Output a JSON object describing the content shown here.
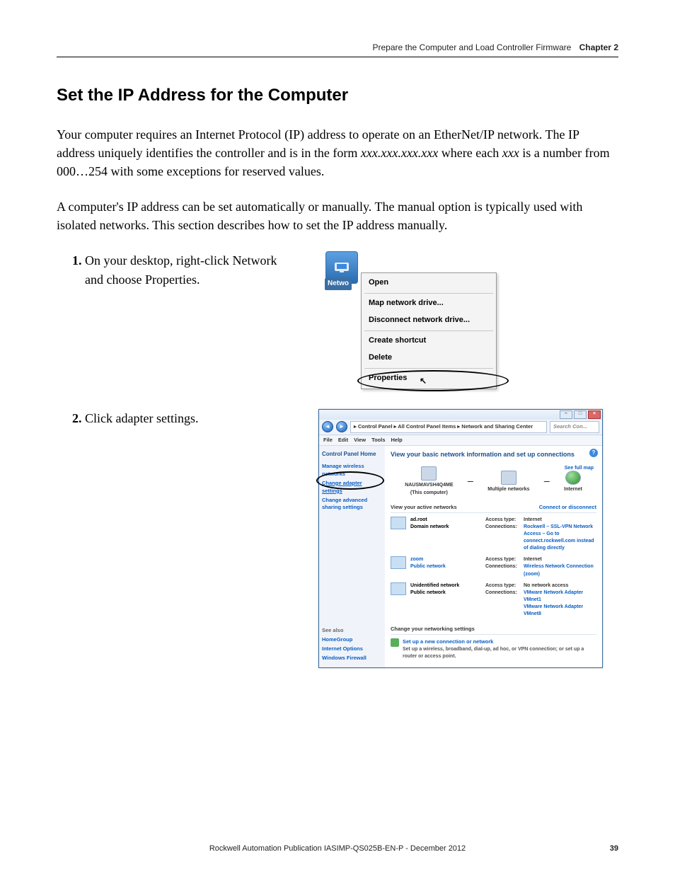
{
  "header": {
    "running_title": "Prepare the Computer and Load Controller Firmware",
    "chapter_label": "Chapter 2"
  },
  "section": {
    "title": "Set the IP Address for the Computer",
    "para1_a": "Your computer requires an Internet Protocol (IP) address to operate on an EtherNet/IP network. The IP address uniquely identifies the controller and is in the form ",
    "para1_b": "xxx.xxx.xxx.xxx",
    "para1_c": " where each ",
    "para1_d": "xxx",
    "para1_e": " is a number from 000…254 with some exceptions for reserved values.",
    "para2": "A computer's IP address can be set automatically or manually. The manual option is typically used with isolated networks. This section describes how to set the IP address manually."
  },
  "steps": {
    "s1": "On your desktop, right-click Network and choose Properties.",
    "s2": "Click adapter settings."
  },
  "context_menu": {
    "icon_label": "Netwo",
    "open": "Open",
    "map_drive": "Map network drive...",
    "disconnect_drive": "Disconnect network drive...",
    "create_shortcut": "Create shortcut",
    "delete": "Delete",
    "properties": "Properties"
  },
  "ncs": {
    "breadcrumb": "▸ Control Panel ▸ All Control Panel Items ▸ Network and Sharing Center",
    "search_placeholder": "Search Con...",
    "menu": {
      "file": "File",
      "edit": "Edit",
      "view": "View",
      "tools": "Tools",
      "help": "Help"
    },
    "side": {
      "home": "Control Panel Home",
      "manage": "Manage wireless networks",
      "adapter": "Change adapter settings",
      "advanced": "Change advanced sharing settings",
      "seealso": "See also",
      "homegroup": "HomeGroup",
      "inetopt": "Internet Options",
      "firewall": "Windows Firewall"
    },
    "main": {
      "title": "View your basic network information and set up connections",
      "see_full": "See full map",
      "computer": "NAUSMAVSH4Q4ME",
      "computer_sub": "(This computer)",
      "multi": "Multiple networks",
      "internet": "Internet",
      "active_title": "View your active networks",
      "connect_dc": "Connect or disconnect",
      "net1": {
        "name": "ad.root",
        "type": "Domain network",
        "access_lbl": "Access type:",
        "access_val": "Internet",
        "conn_lbl": "Connections:",
        "conn_val": "Rockwell – SSL-VPN Network Access – Go to connect.rockwell.com instead of dialing directly"
      },
      "net2": {
        "name": "zoom",
        "type": "Public network",
        "access_lbl": "Access type:",
        "access_val": "Internet",
        "conn_lbl": "Connections:",
        "conn_val": "Wireless Network Connection (zoom)"
      },
      "net3": {
        "name": "Unidentified network",
        "type": "Public network",
        "access_lbl": "Access type:",
        "access_val": "No network access",
        "conn_lbl": "Connections:",
        "conn_val1": "VMware Network Adapter VMnet1",
        "conn_val2": "VMware Network Adapter VMnet8"
      },
      "change_title": "Change your networking settings",
      "setup_t": "Set up a new connection or network",
      "setup_d": "Set up a wireless, broadband, dial-up, ad hoc, or VPN connection; or set up a router or access point."
    }
  },
  "footer": {
    "pub": "Rockwell Automation Publication IASIMP-QS025B-EN-P - December 2012",
    "page": "39"
  }
}
